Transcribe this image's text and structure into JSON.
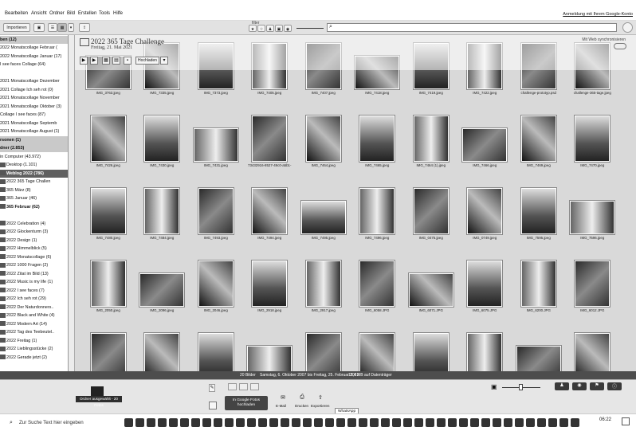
{
  "menu": [
    "Bearbeiten",
    "Ansicht",
    "Ordner",
    "Bild",
    "Erstellen",
    "Tools",
    "Hilfe"
  ],
  "signin": "Anmeldung mit Ihrem Google-Konto",
  "toolbar": {
    "import_label": "Importieren",
    "filter_label": "filter"
  },
  "sidebar": {
    "items": [
      {
        "label": "ben (12)",
        "type": "hdr"
      },
      {
        "label": "2022 Monatscollage Februar (",
        "type": "item"
      },
      {
        "label": "2022 Monatscollage Januar (17)",
        "type": "item"
      },
      {
        "label": "I see faces Collage (64)",
        "type": "item"
      },
      {
        "label": "",
        "type": "item"
      },
      {
        "label": "2021 Monatscollage Dezember",
        "type": "item"
      },
      {
        "label": "2021 Collage Ich seh rot (0)",
        "type": "item"
      },
      {
        "label": "2021 Monatscollage November",
        "type": "item"
      },
      {
        "label": "2021 Monatscollage Oktober (3)",
        "type": "item"
      },
      {
        "label": "Collage I see faces (87)",
        "type": "item"
      },
      {
        "label": "2021 Monatscollage Septemb",
        "type": "item"
      },
      {
        "label": "2021 Monatscollage August (1)",
        "type": "item"
      },
      {
        "label": "rsonen (1)",
        "type": "hdr"
      },
      {
        "label": "dner (2.853)",
        "type": "hdr"
      },
      {
        "label": "in Computer (43.972)",
        "type": "item"
      },
      {
        "label": "Desktop (1.101)",
        "type": "item"
      },
      {
        "label": "Weblog 2022 (786)",
        "type": "sel"
      },
      {
        "label": "2022 365 Tage Challen",
        "type": "item"
      },
      {
        "label": "365 März (8)",
        "type": "item"
      },
      {
        "label": "365 Januar (46)",
        "type": "item"
      },
      {
        "label": "365 Februar (62)",
        "type": "bold"
      },
      {
        "label": "",
        "type": "item"
      },
      {
        "label": "2022 Celebration (4)",
        "type": "item"
      },
      {
        "label": "2022 Glockenturm (3)",
        "type": "item"
      },
      {
        "label": "2022 Design (1)",
        "type": "item"
      },
      {
        "label": "2022 Himmelblick (5)",
        "type": "item"
      },
      {
        "label": "2022 Monatscollage (6)",
        "type": "item"
      },
      {
        "label": "2022 1000 Fragen (2)",
        "type": "item"
      },
      {
        "label": "2022 Zitat im Bild (13)",
        "type": "item"
      },
      {
        "label": "2022 Music is my life (1)",
        "type": "item"
      },
      {
        "label": "2022 I see faces (7)",
        "type": "item"
      },
      {
        "label": "2022 Ich seh rot (29)",
        "type": "item"
      },
      {
        "label": "2022 Der Naturdonners..",
        "type": "item"
      },
      {
        "label": "2022 Black and White (4)",
        "type": "item"
      },
      {
        "label": "2022 Modern Art (14)",
        "type": "item"
      },
      {
        "label": "2022 Tag des Teebeutel..",
        "type": "item"
      },
      {
        "label": "2022 Freitag (1)",
        "type": "item"
      },
      {
        "label": "2022 Lieblingsstücke (2)",
        "type": "item"
      },
      {
        "label": "2022 Gerade jetzt (2)",
        "type": "item"
      }
    ]
  },
  "album": {
    "title": "2022 365 Tage Challenge",
    "date": "Freitag, 21. Mai 2021",
    "websync": "Mit Web synchronisieren",
    "upload_label": "Hochladen"
  },
  "photos": [
    [
      "IMG_3763.jpeg",
      "IMG_7335.jpeg",
      "IMG_7373.jpeg",
      "IMG_7405.jpeg",
      "IMG_7407.jpeg",
      "IMG_7418.jpeg",
      "IMG_7419.jpeg",
      "IMG_7422.jpeg",
      "challenge-prototyp.psd",
      "challenge-365-tage.jpeg"
    ],
    [
      "IMG_7426.jpeg",
      "IMG_7430.jpeg",
      "IMG_7431.jpeg",
      "73432916-8527-49c0-a5b1-",
      "IMG_7464.jpeg",
      "IMG_7465.jpeg",
      "IMG_7464 (1).jpeg",
      "IMG_7466.jpeg",
      "IMG_7469.jpeg",
      "IMG_7470.jpeg"
    ],
    [
      "IMG_7480.jpeg",
      "IMG_7484.jpeg",
      "IMG_7493.jpeg",
      "IMG_7494.jpeg",
      "IMG_7495.jpeg",
      "IMG_7496.jpeg",
      "IMG_0475.jpeg",
      "IMG_0749.jpeg",
      "IMG_7595.jpeg",
      "IMG_7596.jpeg"
    ],
    [
      "IMG_2050.jpeg",
      "IMG_2096.jpeg",
      "IMG_2046.jpeg",
      "IMG_2918.jpeg",
      "IMG_2917.jpeg",
      "IMG_6058.JPG",
      "IMG_6071.JPG",
      "IMG_6075.JPG",
      "IMG_6200.JPG",
      "IMG_6012.JPG"
    ],
    [
      "",
      "",
      "",
      "",
      "",
      "",
      "",
      "",
      "",
      ""
    ]
  ],
  "status": {
    "count": "20 Bilder",
    "range": "Samstag, 6. Oktober 2007 bis Freitag, 25. Februar 2022",
    "size": "15,4 MB auf Datenträger"
  },
  "bottom": {
    "selection_label": "Ordner ausgewählt - 20 Fotos",
    "google_photos_label": "In Google Fotos hochladen",
    "email_label": "E-Mail",
    "print_label": "Drucken",
    "export_label": "Exportieren",
    "tooltip": "WhatsApp"
  },
  "taskbar": {
    "search_placeholder": "Zur Suche Text hier eingeben",
    "clock": "06:22"
  }
}
